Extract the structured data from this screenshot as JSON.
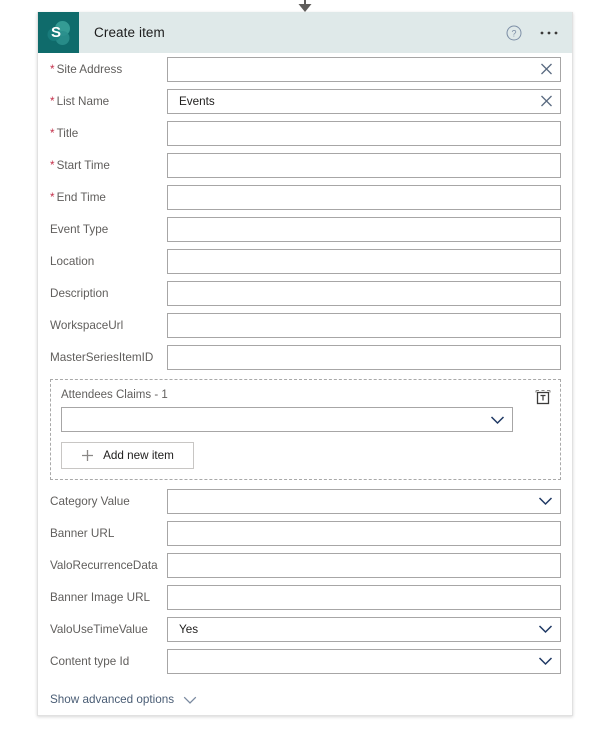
{
  "connector": {
    "arrow_icon": "arrow-down-icon"
  },
  "header": {
    "app_icon": "sharepoint-icon",
    "title": "Create item",
    "help_icon": "help-circle-icon",
    "more_icon": "ellipsis-icon",
    "background_color": "#dfe9e9",
    "logo_color": "#0f6b6b"
  },
  "colors": {
    "required_star": "#c4314b",
    "label_text": "#605e5c",
    "value_text": "#201f1e",
    "link_text": "#4a5d75",
    "input_border": "#a7a6a6",
    "chevron": "#1f3864"
  },
  "form": {
    "fields": [
      {
        "label": "Site Address",
        "required": true,
        "value": "",
        "trailing": "clear-x-icon"
      },
      {
        "label": "List Name",
        "required": true,
        "value": "Events",
        "trailing": "clear-x-icon"
      },
      {
        "label": "Title",
        "required": true,
        "value": "",
        "trailing": ""
      },
      {
        "label": "Start Time",
        "required": true,
        "value": "",
        "trailing": ""
      },
      {
        "label": "End Time",
        "required": true,
        "value": "",
        "trailing": ""
      },
      {
        "label": "Event Type",
        "required": false,
        "value": "",
        "trailing": ""
      },
      {
        "label": "Location",
        "required": false,
        "value": "",
        "trailing": ""
      },
      {
        "label": "Description",
        "required": false,
        "value": "",
        "trailing": ""
      },
      {
        "label": "WorkspaceUrl",
        "required": false,
        "value": "",
        "trailing": ""
      },
      {
        "label": "MasterSeriesItemID",
        "required": false,
        "value": "",
        "trailing": ""
      }
    ],
    "repeat_group": {
      "title": "Attendees Claims - 1",
      "value": "",
      "dropdown_icon": "chevron-down-icon",
      "delete_icon": "delete-item-icon",
      "add_button_label": "Add new item",
      "add_button_icon": "plus-icon"
    },
    "fields_after": [
      {
        "label": "Category Value",
        "required": false,
        "value": "",
        "trailing": "chevron-down-icon"
      },
      {
        "label": "Banner URL",
        "required": false,
        "value": "",
        "trailing": ""
      },
      {
        "label": "ValoRecurrenceData",
        "required": false,
        "value": "",
        "trailing": ""
      },
      {
        "label": "Banner Image URL",
        "required": false,
        "value": "",
        "trailing": ""
      },
      {
        "label": "ValoUseTimeValue",
        "required": false,
        "value": "Yes",
        "trailing": "chevron-down-icon"
      },
      {
        "label": "Content type Id",
        "required": false,
        "value": "",
        "trailing": "chevron-down-icon"
      }
    ],
    "advanced": {
      "label": "Show advanced options",
      "chevron_icon": "chevron-down-icon"
    }
  }
}
